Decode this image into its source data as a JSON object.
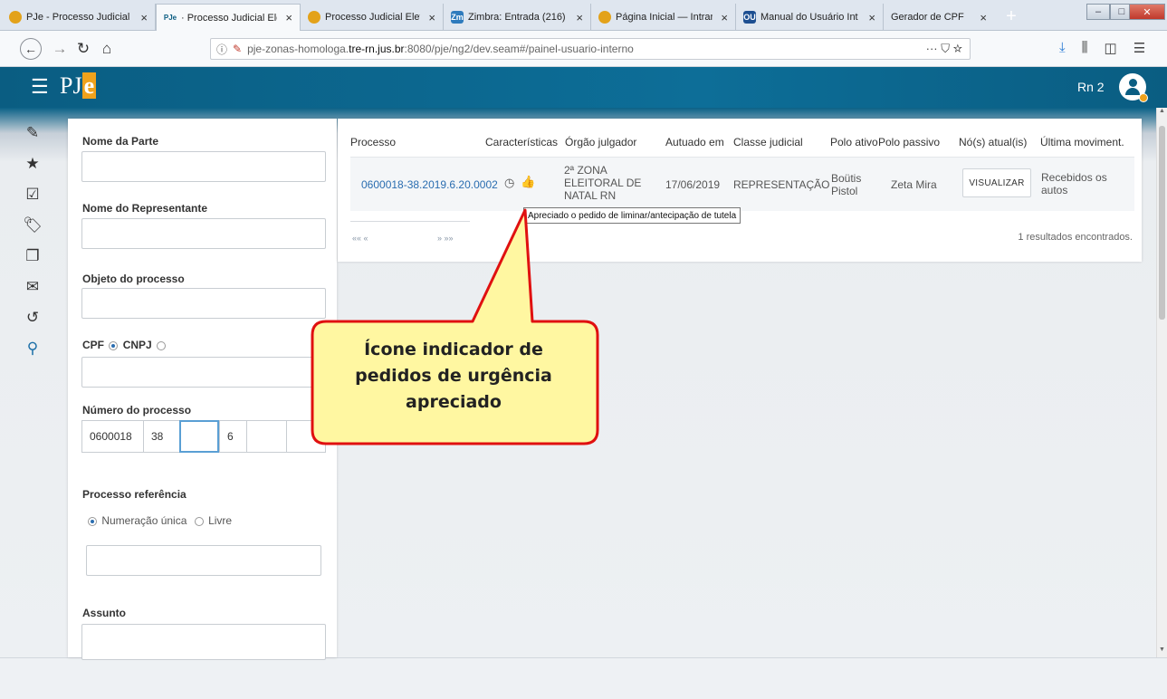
{
  "browser": {
    "tabs": [
      {
        "label": "PJe - Processo Judicial",
        "icon": "globe-icon",
        "icon_color": "#e3a21a"
      },
      {
        "label": "· Processo Judicial Elet",
        "icon": "pje-icon",
        "icon_color": "#ffffff",
        "icon_text": "PJe",
        "active": true
      },
      {
        "label": "Processo Judicial Eletr",
        "icon": "globe-icon",
        "icon_color": "#e3a21a"
      },
      {
        "label": "Zimbra: Entrada (216)",
        "icon": "zimbra-icon",
        "icon_color": "#2e7bbd",
        "icon_text": "Zm"
      },
      {
        "label": "Página Inicial — Intran",
        "icon": "globe-icon",
        "icon_color": "#e3a21a"
      },
      {
        "label": "Manual do Usuário Int",
        "icon": "manual-icon",
        "icon_color": "#1d4f91",
        "icon_text": "OU"
      },
      {
        "label": "Gerador de CPF",
        "icon": "",
        "icon_color": "#dfe6ef"
      }
    ],
    "tab_close_glyph": "×",
    "new_tab_glyph": "+",
    "url_prefix": "pje-zonas-homologa.",
    "url_domain": "tre-rn.jus.br",
    "url_suffix": ":8080/pje/ng2/dev.seam#/painel-usuario-interno",
    "url_actions": "··· ⛉ ☆",
    "window_buttons": [
      "–",
      "□",
      "✕"
    ]
  },
  "app": {
    "logo_pj": "PJ",
    "logo_e": "e",
    "user_name": "Rn 2"
  },
  "search_form": {
    "nome_parte_label": "Nome da Parte",
    "nome_representante_label": "Nome do Representante",
    "objeto_processo_label": "Objeto do processo",
    "cpf_label": "CPF",
    "cnpj_label": "CNPJ",
    "numero_processo_label": "Número do processo",
    "numero_segments": [
      "0600018",
      "38",
      "",
      "6",
      "",
      ""
    ],
    "processo_referencia_label": "Processo referência",
    "numeracao_unica_label": "Numeração única",
    "livre_label": "Livre",
    "assunto_label": "Assunto"
  },
  "results": {
    "headers": [
      "Processo",
      "Características",
      "Órgão julgador",
      "Autuado em",
      "Classe judicial",
      "Polo ativo",
      "Polo passivo",
      "Nó(s) atual(is)",
      "Última moviment."
    ],
    "row": {
      "processo": "0600018-38.2019.6.20.0002",
      "orgao_line1": "2ª ZONA",
      "orgao_line2": "ELEITORAL DE",
      "orgao_line3": "NATAL RN",
      "autuado_em": "17/06/2019",
      "classe_judicial": "REPRESENTAÇÃO",
      "polo_ativo_line1": "Boütis",
      "polo_ativo_line2": "Pistol",
      "polo_passivo": "Zeta Mira",
      "no_atual_button": "VISUALIZAR",
      "ultima_mov_line1": "Recebidos os",
      "ultima_mov_line2": "autos"
    },
    "pager_first": "«« «",
    "pager_last": "» »»",
    "count_text": "1 resultados encontrados."
  },
  "tooltip": "Apreciado o pedido de liminar/antecipação de tutela",
  "callout": {
    "line1": "Ícone indicador de",
    "line2": "pedidos de urgência",
    "line3": "apreciado",
    "fill_color": "#fff7a1",
    "stroke_color": "#e01010"
  }
}
